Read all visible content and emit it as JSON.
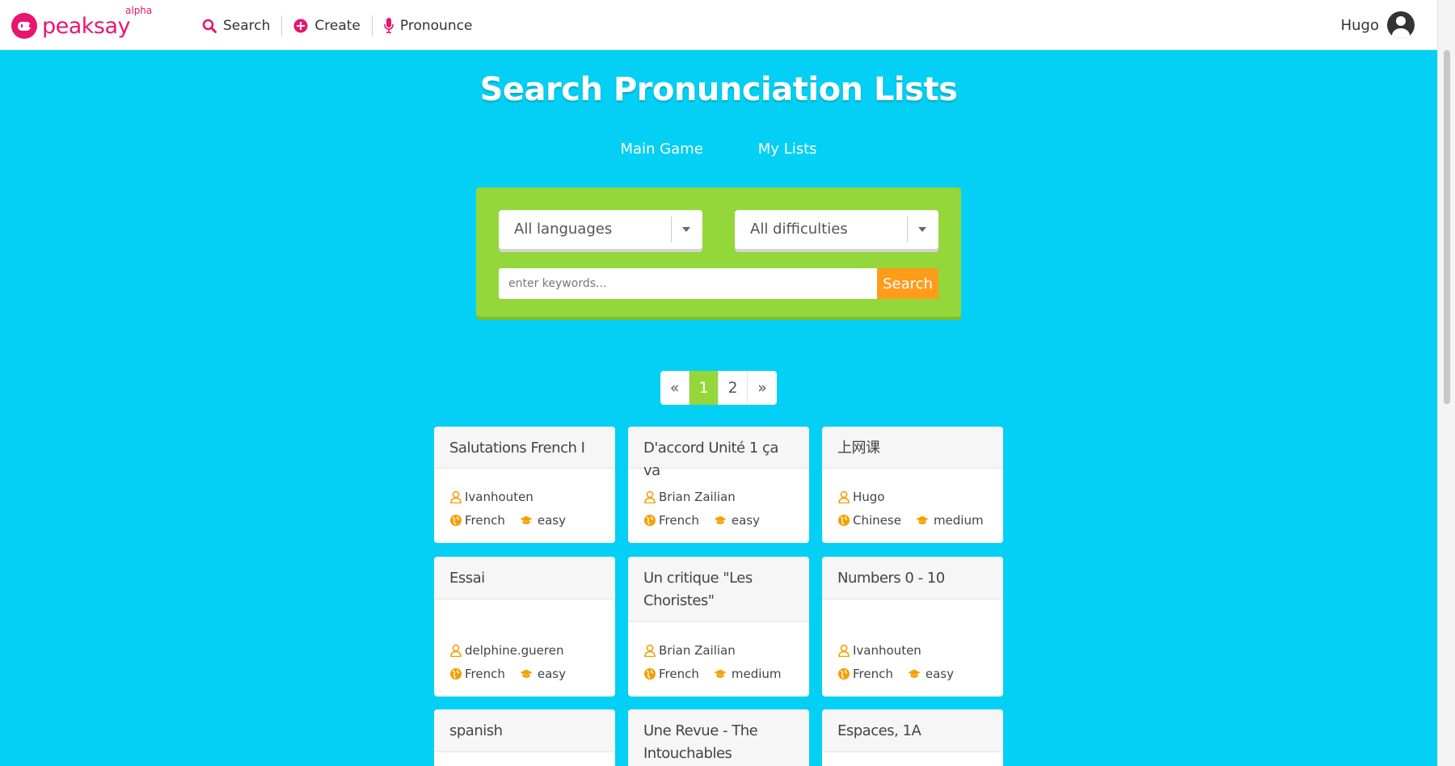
{
  "header": {
    "logo_text": "peaksay",
    "logo_badge": "alpha",
    "nav": [
      {
        "label": "Search",
        "icon": "search-icon"
      },
      {
        "label": "Create",
        "icon": "plus-circle-icon"
      },
      {
        "label": "Pronounce",
        "icon": "microphone-icon"
      }
    ],
    "user_name": "Hugo"
  },
  "colors": {
    "brand": "#e8166f",
    "background": "#03d0f4",
    "panel": "#94d73a",
    "accent": "#ff9c1a"
  },
  "page": {
    "title": "Search Pronunciation Lists",
    "links": [
      "Main Game",
      "My Lists"
    ]
  },
  "search": {
    "language_select": "All languages",
    "difficulty_select": "All difficulties",
    "keywords_placeholder": "enter keywords...",
    "button_label": "Search"
  },
  "pagination": {
    "prev": "«",
    "pages": [
      "1",
      "2"
    ],
    "current": "1",
    "next": "»"
  },
  "cards": [
    {
      "title": "Salutations French I",
      "author": "Ivanhouten",
      "language": "French",
      "difficulty": "easy"
    },
    {
      "title": "D'accord Unité 1 ça va",
      "author": "Brian Zailian",
      "language": "French",
      "difficulty": "easy"
    },
    {
      "title": "上网课",
      "author": "Hugo",
      "language": "Chinese",
      "difficulty": "medium"
    },
    {
      "title": "Essai",
      "author": "delphine.gueren",
      "language": "French",
      "difficulty": "easy"
    },
    {
      "title": "Un critique \"Les Choristes\"",
      "author": "Brian Zailian",
      "language": "French",
      "difficulty": "medium"
    },
    {
      "title": "Numbers 0 - 10",
      "author": "Ivanhouten",
      "language": "French",
      "difficulty": "easy"
    },
    {
      "title": "spanish",
      "author": "",
      "language": "",
      "difficulty": ""
    },
    {
      "title": "Une Revue - The Intouchables",
      "author": "",
      "language": "",
      "difficulty": ""
    },
    {
      "title": "Espaces, 1A",
      "author": "",
      "language": "",
      "difficulty": ""
    }
  ]
}
